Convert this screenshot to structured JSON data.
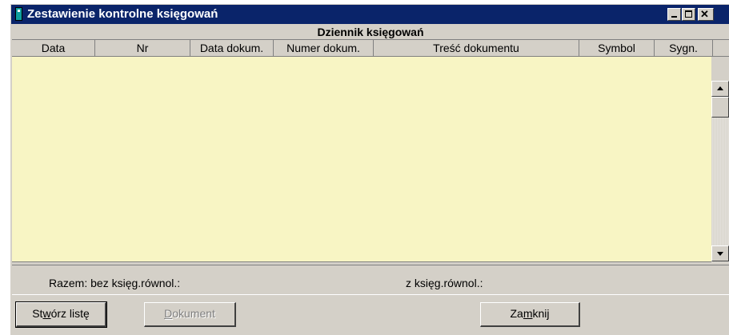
{
  "window": {
    "title": "Zestawienie kontrolne księgowań",
    "controls": {
      "minimize": "minimize",
      "maximize": "maximize",
      "close": "close"
    }
  },
  "grid": {
    "group_header": "Dziennik księgowań",
    "columns": [
      "Data",
      "Nr",
      "Data dokum.",
      "Numer dokum.",
      "Treść dokumentu",
      "Symbol",
      "Sygn."
    ],
    "rows": [],
    "background_color": "#f8f5c4"
  },
  "totals": {
    "label_without": "Razem: bez księg.równol.:",
    "label_with": "z księg.równol.:"
  },
  "buttons": {
    "create_list": {
      "label": "Stwórz listę",
      "mnemonic": "w",
      "enabled": true
    },
    "document": {
      "label": "Dokument",
      "mnemonic": "D",
      "enabled": false
    },
    "close": {
      "label": "Zamknij",
      "mnemonic": "m",
      "enabled": true
    }
  },
  "colors": {
    "title_bar": "#0a246a",
    "face": "#d4d0c8"
  },
  "icons": {
    "app": "app-icon",
    "scroll_up": "scroll-up-arrow-icon",
    "scroll_down": "scroll-down-arrow-icon"
  }
}
